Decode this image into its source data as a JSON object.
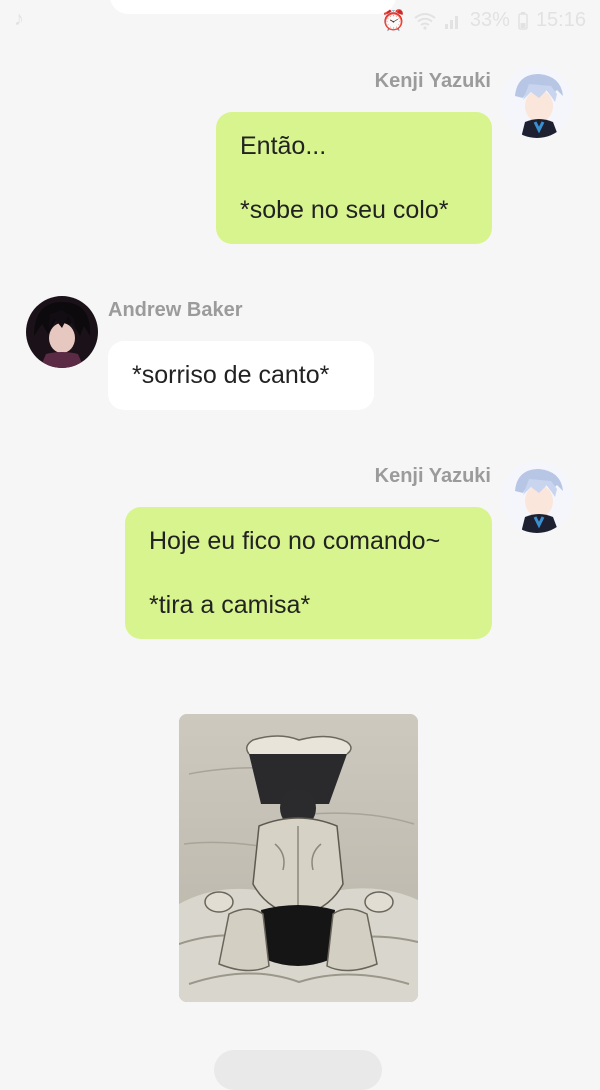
{
  "status_bar": {
    "app_icon": "tiktok-icon",
    "battery": "33%",
    "time": "15:16",
    "icons": [
      "alarm-icon",
      "wifi-icon",
      "signal-icon",
      "battery-icon"
    ]
  },
  "messages": [
    {
      "sender": "Kenji Yazuki",
      "side": "right",
      "lines": [
        "Então...",
        "*sobe no seu colo*"
      ]
    },
    {
      "sender": "Andrew Baker",
      "side": "left",
      "lines": [
        "*sorriso de canto*"
      ]
    },
    {
      "sender": "Kenji Yazuki",
      "side": "right",
      "lines": [
        "Hoje eu fico no comando~",
        "*tira a camisa*"
      ]
    }
  ],
  "image_message": {
    "type": "illustration",
    "subject": "back-view-figure-image"
  },
  "colors": {
    "background": "#f6f6f6",
    "outgoing_bubble": "#d8f48f",
    "incoming_bubble": "#ffffff",
    "sender_name": "#9b9b9b"
  }
}
